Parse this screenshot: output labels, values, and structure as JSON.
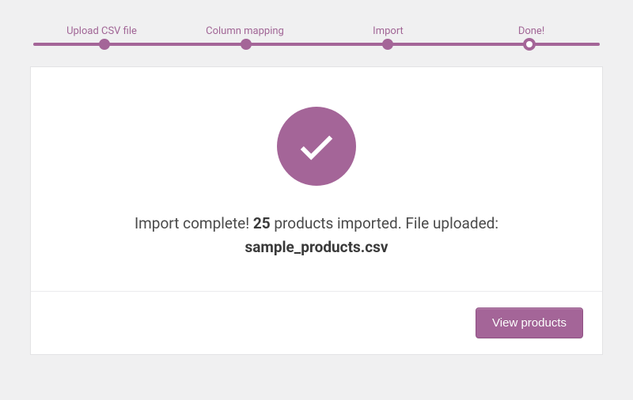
{
  "stepper": {
    "steps": [
      {
        "label": "Upload CSV file",
        "pos": 12.5
      },
      {
        "label": "Column mapping",
        "pos": 37.5
      },
      {
        "label": "Import",
        "pos": 62.5
      },
      {
        "label": "Done!",
        "pos": 87.5
      }
    ],
    "active_index": 3
  },
  "result": {
    "msg_prefix": "Import complete! ",
    "count": "25",
    "msg_suffix": " products imported. File uploaded:",
    "filename": "sample_products.csv"
  },
  "actions": {
    "view_products": "View products"
  },
  "colors": {
    "accent": "#a46598"
  }
}
